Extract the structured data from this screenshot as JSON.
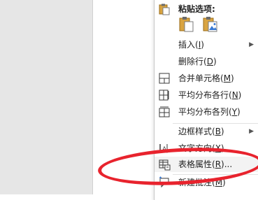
{
  "menu": {
    "paste_options_title": "粘贴选项:",
    "paste_icons": [
      "paste-keep-format-icon",
      "paste-picture-icon"
    ],
    "items": [
      {
        "name": "insert",
        "text": "插入(",
        "accel": "I",
        "suffix": ")",
        "has_submenu": true,
        "icon": ""
      },
      {
        "name": "delete-row",
        "text": "删除行(",
        "accel": "D",
        "suffix": ")",
        "has_submenu": false,
        "icon": ""
      },
      {
        "name": "merge-cells",
        "text": "合并单元格(",
        "accel": "M",
        "suffix": ")",
        "has_submenu": false,
        "icon": "merge-cells-icon"
      },
      {
        "name": "distribute-rows",
        "text": "平均分布各行(",
        "accel": "N",
        "suffix": ")",
        "has_submenu": false,
        "icon": "distribute-rows-icon"
      },
      {
        "name": "distribute-cols",
        "text": "平均分布各列(",
        "accel": "Y",
        "suffix": ")",
        "has_submenu": false,
        "icon": "distribute-columns-icon"
      },
      {
        "name": "border-styles",
        "text": "边框样式(",
        "accel": "B",
        "suffix": ")",
        "has_submenu": true,
        "icon": ""
      },
      {
        "name": "text-direction",
        "text": "文字方向(",
        "accel": "X",
        "suffix": ")...",
        "has_submenu": false,
        "icon": "text-direction-icon"
      },
      {
        "name": "table-properties",
        "text": "表格属性(",
        "accel": "R",
        "suffix": ")...",
        "has_submenu": false,
        "icon": "table-properties-icon"
      },
      {
        "name": "new-comment",
        "text": "新建批注(",
        "accel": "M",
        "suffix": ")",
        "has_submenu": false,
        "icon": "new-comment-icon"
      }
    ]
  },
  "colors": {
    "highlight_ellipse": "#e8232d",
    "left_panel": "#e6e6e6",
    "menu_bg": "#ffffff"
  }
}
